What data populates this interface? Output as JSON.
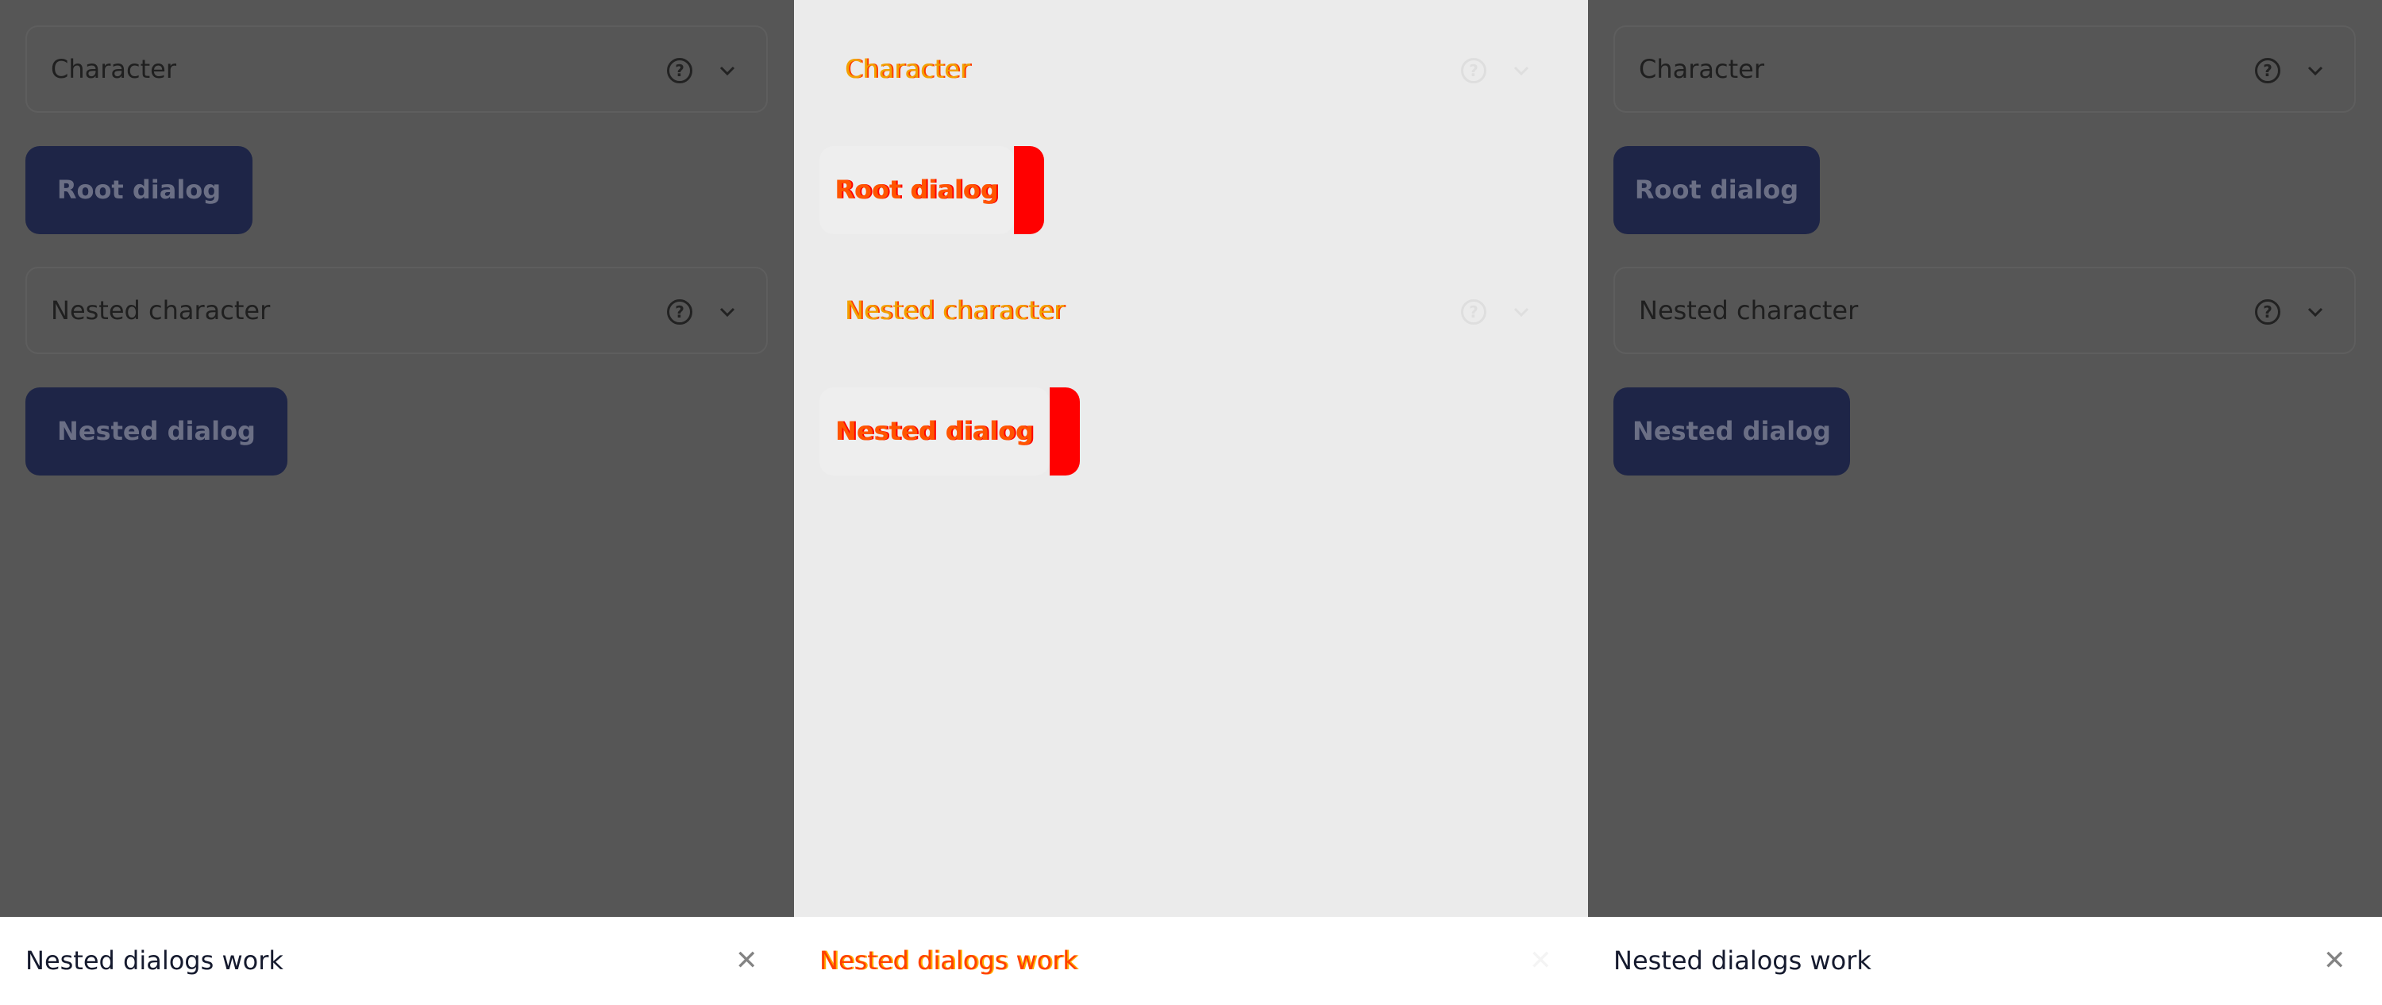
{
  "form": {
    "character_label": "Character",
    "root_dialog_label": "Root dialog",
    "nested_character_label": "Nested character",
    "nested_dialog_label": "Nested dialog"
  },
  "toast": {
    "message": "Nested dialogs work",
    "close_glyph": "✕"
  },
  "icons": {
    "help": "help-circle-icon",
    "chevron": "chevron-down-icon",
    "close": "close-icon"
  },
  "colors": {
    "overlay": "#565656",
    "button": "#1e2547",
    "diff_highlight": "#ff0000"
  }
}
